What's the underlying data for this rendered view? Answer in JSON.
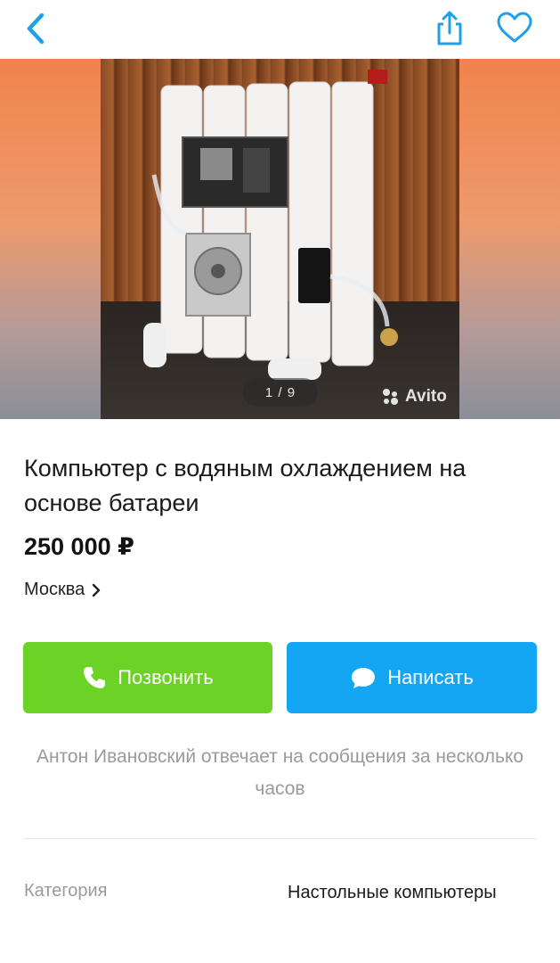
{
  "icons": {
    "back": "chevron-left-icon",
    "share": "share-icon",
    "favorite": "heart-icon",
    "call": "phone-icon",
    "message": "chat-bubble-icon",
    "location": "chevron-right-icon",
    "watermark": "avito-logo"
  },
  "colors": {
    "accent": "#1ea1e6",
    "call_button": "#6cd326",
    "message_button": "#14a6f2",
    "muted_text": "#9a9a9a"
  },
  "gallery": {
    "counter": "1 / 9",
    "watermark": "Avito"
  },
  "listing": {
    "title": "Компьютер с водяным охлаждением на основе батареи",
    "price": "250 000 ₽",
    "location": "Москва"
  },
  "actions": {
    "call_label": "Позвонить",
    "message_label": "Написать"
  },
  "seller_note": "Антон Ивановский отвечает на сообщения за несколько часов",
  "params": [
    {
      "name": "Категория",
      "value": "Настольные компьютеры"
    }
  ]
}
